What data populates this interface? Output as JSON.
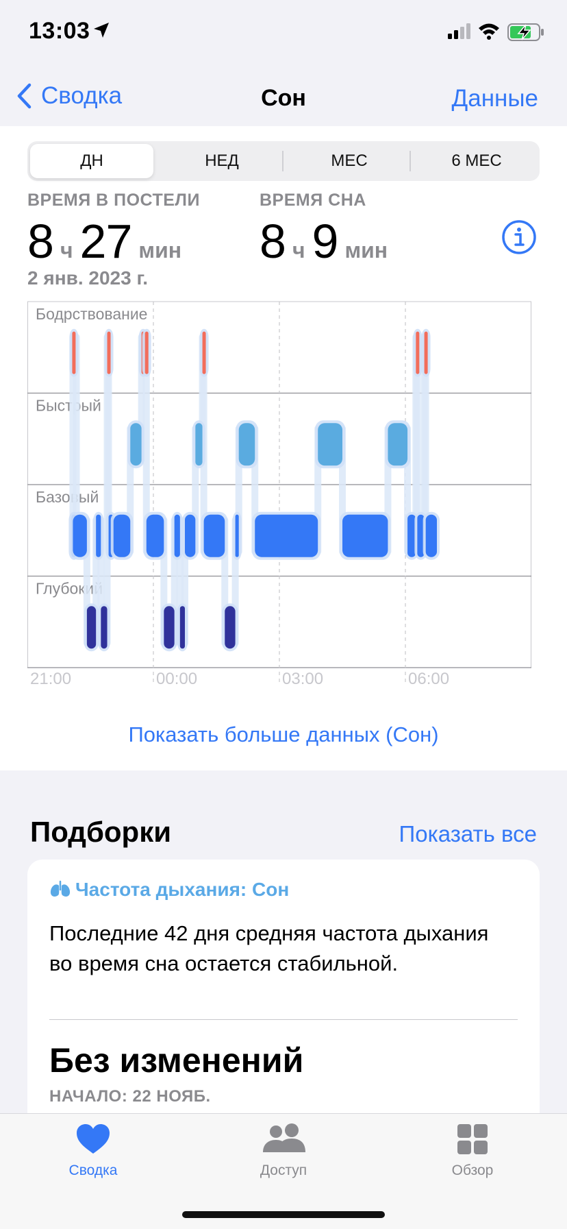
{
  "status_bar": {
    "time": "13:03"
  },
  "nav": {
    "back_label": "Сводка",
    "title": "Сон",
    "right_label": "Данные"
  },
  "segments": [
    {
      "label": "ДН",
      "active": true
    },
    {
      "label": "НЕД",
      "active": false
    },
    {
      "label": "МЕС",
      "active": false
    },
    {
      "label": "6 МЕС",
      "active": false
    }
  ],
  "stats": {
    "in_bed": {
      "label": "ВРЕМЯ В ПОСТЕЛИ",
      "hours": "8",
      "hours_unit": "ч",
      "minutes": "27",
      "minutes_unit": "мин"
    },
    "asleep": {
      "label": "ВРЕМЯ СНА",
      "hours": "8",
      "hours_unit": "ч",
      "minutes": "9",
      "minutes_unit": "мин"
    },
    "date": "2 янв. 2023 г."
  },
  "chart_data": {
    "type": "sleep-stages",
    "stages": [
      "Бодрствование",
      "Быстрый",
      "Базовый",
      "Глубокий"
    ],
    "x_ticks": [
      "21:00",
      "00:00",
      "03:00",
      "06:00"
    ],
    "x_range": [
      "21:00",
      "09:00"
    ],
    "colors": {
      "awake": "#f26d5b",
      "rem": "#5aabe0",
      "core": "#3478f6",
      "deep": "#30329b"
    },
    "segments": [
      {
        "stage": "Базовый",
        "start": "22:03",
        "end": "22:10"
      },
      {
        "stage": "Бодрствование",
        "start": "22:04",
        "end": "22:05"
      },
      {
        "stage": "Базовый",
        "start": "22:05",
        "end": "22:25"
      },
      {
        "stage": "Глубокий",
        "start": "22:25",
        "end": "22:38"
      },
      {
        "stage": "Базовый",
        "start": "22:38",
        "end": "22:45"
      },
      {
        "stage": "Глубокий",
        "start": "22:45",
        "end": "22:54"
      },
      {
        "stage": "Бодрствование",
        "start": "22:54",
        "end": "22:56"
      },
      {
        "stage": "Базовый",
        "start": "22:56",
        "end": "23:03"
      },
      {
        "stage": "Базовый",
        "start": "23:03",
        "end": "23:27"
      },
      {
        "stage": "Быстрый",
        "start": "23:27",
        "end": "23:43"
      },
      {
        "stage": "Бодрствование",
        "start": "23:43",
        "end": "23:45"
      },
      {
        "stage": "Бодрствование",
        "start": "23:48",
        "end": "23:50"
      },
      {
        "stage": "Базовый",
        "start": "23:50",
        "end": "24:15"
      },
      {
        "stage": "Глубокий",
        "start": "24:15",
        "end": "24:30"
      },
      {
        "stage": "Базовый",
        "start": "24:30",
        "end": "24:38"
      },
      {
        "stage": "Глубокий",
        "start": "24:38",
        "end": "24:45"
      },
      {
        "stage": "Базовый",
        "start": "24:45",
        "end": "25:00"
      },
      {
        "stage": "Быстрый",
        "start": "25:00",
        "end": "25:10"
      },
      {
        "stage": "Бодрствование",
        "start": "25:10",
        "end": "25:12"
      },
      {
        "stage": "Базовый",
        "start": "25:12",
        "end": "25:42"
      },
      {
        "stage": "Глубокий",
        "start": "25:42",
        "end": "25:57"
      },
      {
        "stage": "Базовый",
        "start": "25:57",
        "end": "26:02"
      },
      {
        "stage": "Быстрый",
        "start": "26:02",
        "end": "26:25"
      },
      {
        "stage": "Базовый",
        "start": "26:25",
        "end": "27:55"
      },
      {
        "stage": "Быстрый",
        "start": "27:55",
        "end": "28:30"
      },
      {
        "stage": "Базовый",
        "start": "28:30",
        "end": "29:35"
      },
      {
        "stage": "Быстрый",
        "start": "29:35",
        "end": "30:03"
      },
      {
        "stage": "Базовый",
        "start": "30:03",
        "end": "30:15"
      },
      {
        "stage": "Бодрствование",
        "start": "30:15",
        "end": "30:17"
      },
      {
        "stage": "Базовый",
        "start": "30:17",
        "end": "30:27"
      },
      {
        "stage": "Бодрствование",
        "start": "30:27",
        "end": "30:29"
      },
      {
        "stage": "Базовый",
        "start": "30:29",
        "end": "30:45"
      }
    ]
  },
  "more_link": "Показать больше данных (Сон)",
  "highlights": {
    "title": "Подборки",
    "show_all": "Показать все",
    "card": {
      "category": "Частота дыхания: Сон",
      "text": "Последние 42 дня средняя частота дыхания во время сна остается стабильной.",
      "value": "Без изменений",
      "start": "НАЧАЛО: 22 НОЯБ."
    }
  },
  "tabs": [
    {
      "label": "Сводка",
      "icon": "heart-icon",
      "active": true
    },
    {
      "label": "Доступ",
      "icon": "people-icon",
      "active": false
    },
    {
      "label": "Обзор",
      "icon": "grid-icon",
      "active": false
    }
  ]
}
